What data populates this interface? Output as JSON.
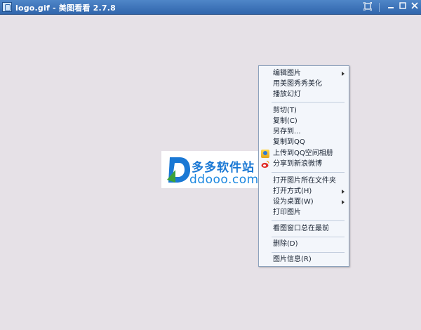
{
  "window": {
    "title": "logo.gif - 美图看看 2.7.8"
  },
  "logo": {
    "cn_text": "多多软件站",
    "en_text": "ddooo.com"
  },
  "colors": {
    "titlebar": "#3a70b8",
    "canvas": "#e6e1e7",
    "menu_bg": "#f3f6fb",
    "logo_blue": "#1a78d4"
  },
  "context_menu": {
    "items": [
      {
        "label": "编辑图片",
        "submenu": true
      },
      {
        "label": "用美图秀秀美化"
      },
      {
        "label": "播放幻灯"
      },
      {
        "label": "剪切(T)"
      },
      {
        "label": "复制(C)"
      },
      {
        "label": "另存到..."
      },
      {
        "label": "复制到QQ"
      },
      {
        "label": "上传到QQ空间相册",
        "icon": "qzone-icon"
      },
      {
        "label": "分享到新浪微博",
        "icon": "weibo-icon"
      },
      {
        "label": "打开图片所在文件夹"
      },
      {
        "label": "打开方式(H)",
        "submenu": true
      },
      {
        "label": "设为桌面(W)",
        "submenu": true
      },
      {
        "label": "打印图片"
      },
      {
        "label": "看图窗口总在最前"
      },
      {
        "label": "删除(D)"
      },
      {
        "label": "图片信息(R)"
      }
    ]
  }
}
